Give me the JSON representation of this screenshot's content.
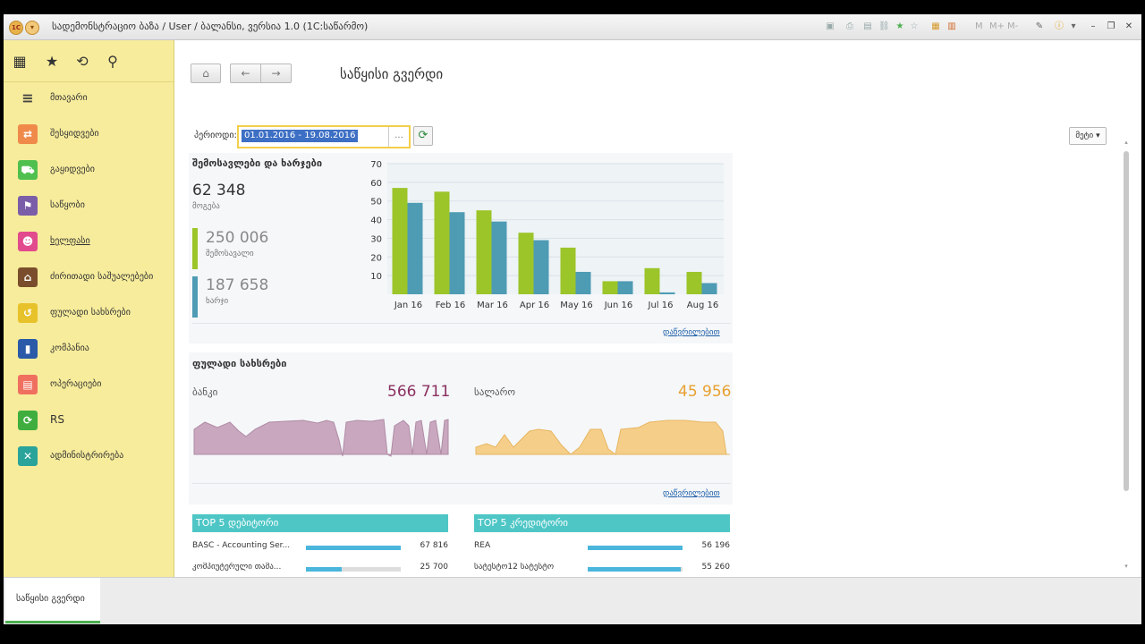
{
  "window": {
    "title": "სადემონსტრაციო ბაზა / User / ბალანსი, ვერსია 1.0  (1C:საწარმო)",
    "toolbar_labels": [
      "M",
      "M+",
      "M-"
    ]
  },
  "nav": {
    "items": [
      {
        "label": "მთავარი",
        "icon": "menu-icon",
        "color": "#555555"
      },
      {
        "label": "შესყიდვები",
        "icon": "truck-icon",
        "color": "#f08a4b"
      },
      {
        "label": "გაყიდვები",
        "icon": "cart-icon",
        "color": "#4fc04f"
      },
      {
        "label": "საწყობი",
        "icon": "warehouse-icon",
        "color": "#7a5ea8"
      },
      {
        "label": "ხელფასი",
        "icon": "people-icon",
        "color": "#e24a8e"
      },
      {
        "label": "ძირითადი საშუალებები",
        "icon": "assets-icon",
        "color": "#7a4e2d"
      },
      {
        "label": "ფულადი სახსრები",
        "icon": "money-icon",
        "color": "#e8c22a"
      },
      {
        "label": "კომპანია",
        "icon": "building-icon",
        "color": "#2a5aa8"
      },
      {
        "label": "ოპერაციები",
        "icon": "operations-icon",
        "color": "#f07060"
      },
      {
        "label": "RS",
        "icon": "rs-icon",
        "color": "#3fae3f"
      },
      {
        "label": "ადმინისტრირება",
        "icon": "tools-icon",
        "color": "#2aa39a"
      }
    ]
  },
  "bottom_tab": "საწყისი გვერდი",
  "page": {
    "title": "საწყისი გვერდი",
    "period_label": "პერიოდი:",
    "period_value": "01.01.2016 - 19.08.2016",
    "period_dots": "...",
    "more_label": "მეტი"
  },
  "income_panel": {
    "title": "შემოსავლები და ხარჯები",
    "profit_value": "62 348",
    "profit_label": "მოგება",
    "income_value": "250 006",
    "income_label": "შემოსავალი",
    "expense_value": "187 658",
    "expense_label": "ხარჯი",
    "details_link": "დაწვრილებით"
  },
  "chart_data": {
    "type": "bar",
    "categories": [
      "Jan 16",
      "Feb 16",
      "Mar 16",
      "Apr 16",
      "May 16",
      "Jun 16",
      "Jul 16",
      "Aug 16"
    ],
    "series": [
      {
        "name": "შემოსავალი",
        "color": "#9cc52a",
        "values": [
          57,
          55,
          45,
          33,
          25,
          7,
          14,
          12
        ]
      },
      {
        "name": "ხარჯი",
        "color": "#4e9bb4",
        "values": [
          49,
          44,
          39,
          29,
          12,
          7,
          1,
          6
        ]
      }
    ],
    "ylim": [
      0,
      70
    ],
    "yticks": [
      10,
      20,
      30,
      40,
      50,
      60,
      70
    ],
    "grid": true
  },
  "cash_panel": {
    "title": "ფულადი სახსრები",
    "bank_label": "ბანკი",
    "bank_value": "566 711",
    "cash_label": "სალარო",
    "cash_value": "45 956",
    "bank_color": "#8b3060",
    "cash_color": "#e8a030",
    "details_link": "დაწვრილებით"
  },
  "top5": {
    "debtors_title": "TOP 5 დებიტორი",
    "creditors_title": "TOP 5 კრედიტორი",
    "debtors": [
      {
        "name": "BASC - Accounting Ser...",
        "value": "67 816",
        "fill": 1.0
      },
      {
        "name": "კომპიუტერული თამა...",
        "value": "25 700",
        "fill": 0.38
      }
    ],
    "creditors": [
      {
        "name": "REA",
        "value": "56 196",
        "fill": 1.0
      },
      {
        "name": "სატესტო12 სატესტო",
        "value": "55 260",
        "fill": 0.98
      }
    ]
  }
}
